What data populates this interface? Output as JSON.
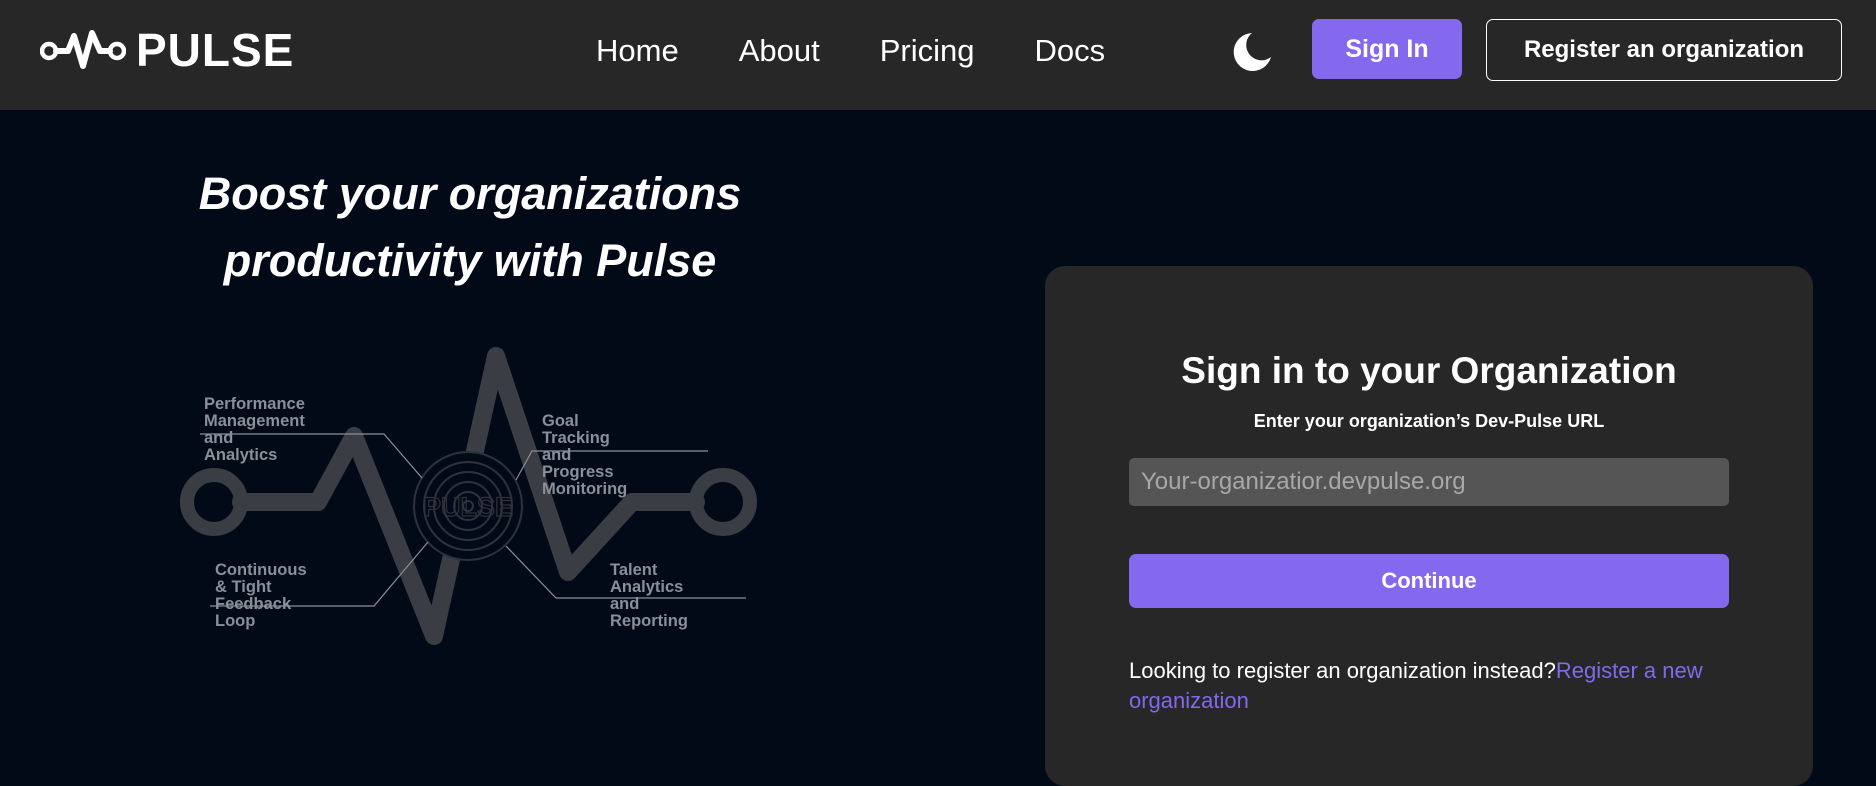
{
  "app": {
    "name": "PULSE"
  },
  "nav": {
    "links": [
      "Home",
      "About",
      "Pricing",
      "Docs"
    ],
    "theme_toggle_icon": "moon-icon",
    "signin_label": "Sign In",
    "register_label": "Register an organization"
  },
  "hero": {
    "title_line1": "Boost your organizations",
    "title_line2": "productivity with Pulse",
    "illustration": {
      "center_text": "PULSE",
      "labels": {
        "performance": "Performance Management\n and Analytics",
        "goal": "Goal Tracking and\nProgress Monitoring",
        "feedback": "Continuous & Tight\nFeedback Loop",
        "talent": "Talent Analytics\nand Reporting"
      }
    }
  },
  "signin_card": {
    "title": "Sign in to your Organization",
    "subtitle": "Enter your organization’s Dev-Pulse URL",
    "url_placeholder": "Your-organizatior.devpulse.org",
    "continue_label": "Continue",
    "register_prompt": "Looking to register an organization instead?",
    "register_link": "Register a new organization"
  },
  "colors": {
    "accent": "#8468ed",
    "navbar_bg": "#272727",
    "page_bg": "#020a18",
    "card_bg": "#272727",
    "illustration": "#3a3d44"
  }
}
